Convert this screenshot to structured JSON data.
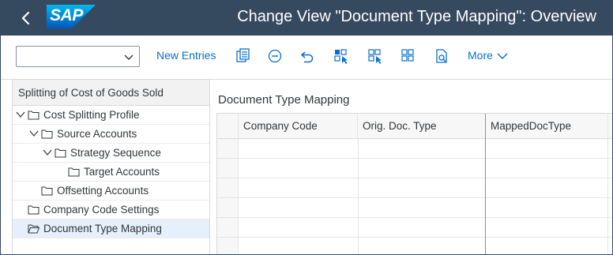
{
  "shell": {
    "title": "Change View \"Document Type Mapping\": Overview",
    "logo_text": "SAP",
    "back_icon": "chevron-left-icon"
  },
  "toolbar": {
    "select_value": "",
    "new_entries_label": "New Entries",
    "more_label": "More",
    "icons": [
      "copy-as-icon",
      "delete-icon",
      "undo-icon",
      "select-all-icon",
      "select-block-icon",
      "deselect-all-icon",
      "display-details-icon"
    ]
  },
  "tree": {
    "header": "Splitting of Cost of Goods Sold",
    "items": [
      {
        "label": "Cost Splitting Profile",
        "level": 0,
        "expanded": true
      },
      {
        "label": "Source Accounts",
        "level": 1,
        "expanded": true
      },
      {
        "label": "Strategy Sequence",
        "level": 2,
        "expanded": true
      },
      {
        "label": "Target Accounts",
        "level": 3,
        "expanded": false
      },
      {
        "label": "Offsetting Accounts",
        "level": 1,
        "expanded": false
      },
      {
        "label": "Company Code Settings",
        "level": 0,
        "expanded": false
      },
      {
        "label": "Document Type Mapping",
        "level": 0,
        "expanded": false,
        "selected": true
      }
    ]
  },
  "content": {
    "title": "Document Type Mapping",
    "columns": [
      "Company Code",
      "Orig. Doc. Type",
      "MappedDocType"
    ],
    "rows": [
      [
        "",
        "",
        ""
      ],
      [
        "",
        "",
        ""
      ],
      [
        "",
        "",
        ""
      ],
      [
        "",
        "",
        ""
      ],
      [
        "",
        "",
        ""
      ],
      [
        "",
        "",
        ""
      ]
    ]
  },
  "colors": {
    "shell_bg": "#354a5f",
    "link_blue": "#0a6ed1",
    "selected_row": "#e5f0fa"
  }
}
